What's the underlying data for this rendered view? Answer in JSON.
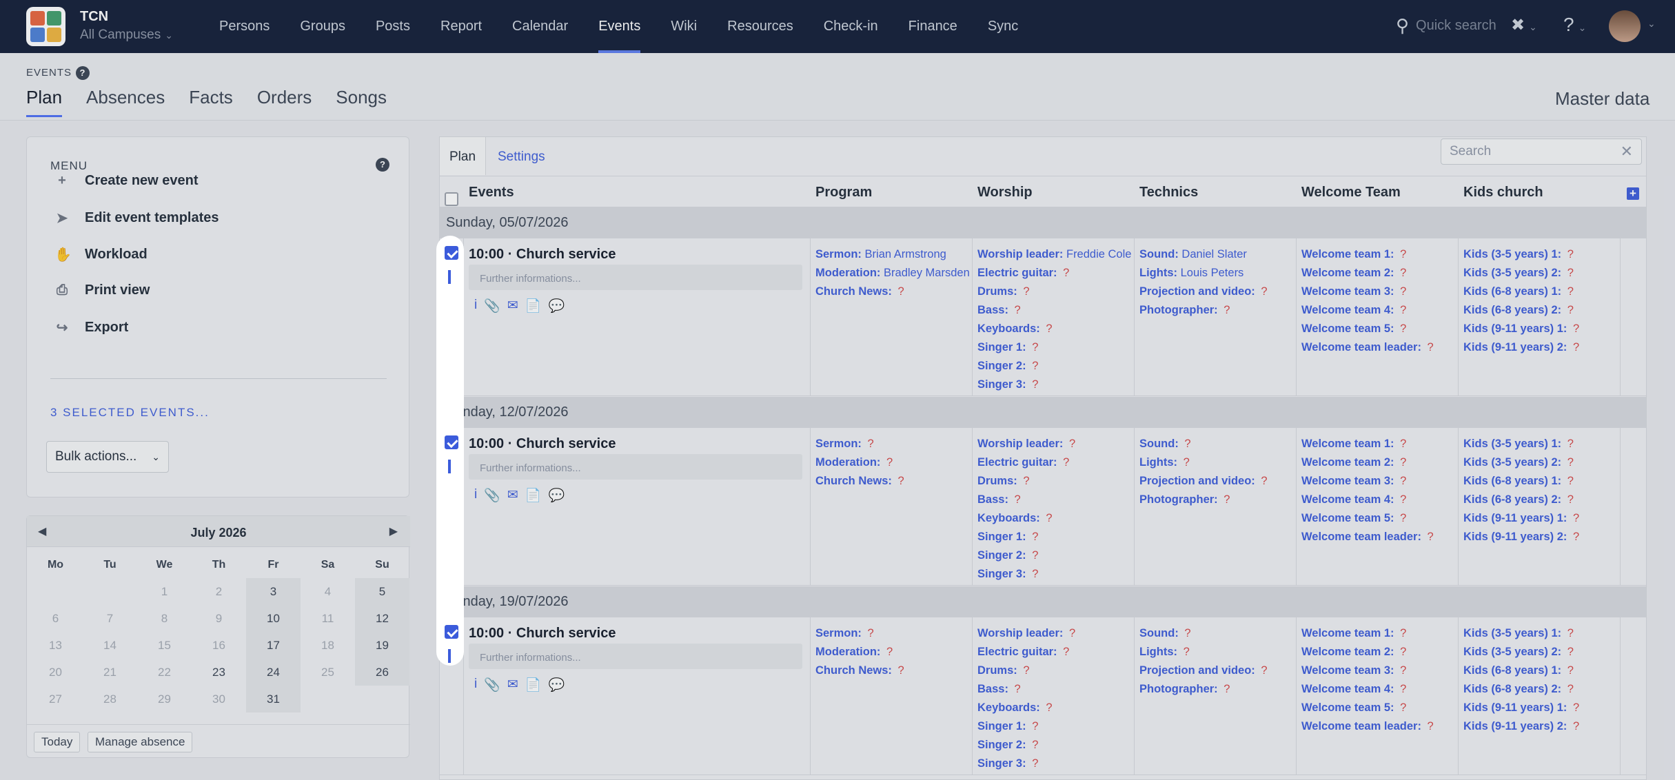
{
  "app": {
    "org": "TCN",
    "campus": "All Campuses"
  },
  "nav": [
    "Persons",
    "Groups",
    "Posts",
    "Report",
    "Calendar",
    "Events",
    "Wiki",
    "Resources",
    "Check-in",
    "Finance",
    "Sync"
  ],
  "nav_active": "Events",
  "quick_search": "Quick search",
  "page": {
    "section_label": "EVENTS",
    "tabs": [
      "Plan",
      "Absences",
      "Facts",
      "Orders",
      "Songs"
    ],
    "active_tab": "Plan",
    "master_data": "Master data"
  },
  "menu": {
    "title": "MENU",
    "items": [
      {
        "label": "Create new event",
        "icon": "plus-icon"
      },
      {
        "label": "Edit event templates",
        "icon": "rocket-icon"
      },
      {
        "label": "Workload",
        "icon": "hand-icon"
      },
      {
        "label": "Print view",
        "icon": "printer-icon"
      },
      {
        "label": "Export",
        "icon": "export-icon"
      }
    ],
    "selected_label": "3 SELECTED EVENTS...",
    "bulk_actions": "Bulk actions..."
  },
  "calendar": {
    "month": "July 2026",
    "weekdays": [
      "Mo",
      "Tu",
      "We",
      "Th",
      "Fr",
      "Sa",
      "Su"
    ],
    "weeks": [
      [
        "",
        "",
        "1",
        "2",
        "3",
        "4",
        "5"
      ],
      [
        "6",
        "7",
        "8",
        "9",
        "10",
        "11",
        "12"
      ],
      [
        "13",
        "14",
        "15",
        "16",
        "17",
        "18",
        "19"
      ],
      [
        "20",
        "21",
        "22",
        "23",
        "24",
        "25",
        "26"
      ],
      [
        "27",
        "28",
        "29",
        "30",
        "31",
        "",
        ""
      ]
    ],
    "today_button": "Today",
    "manage_absence_button": "Manage absence"
  },
  "plan": {
    "tabs": [
      "Plan",
      "Settings"
    ],
    "search_placeholder": "Search",
    "columns": [
      "Events",
      "Program",
      "Worship",
      "Technics",
      "Welcome Team",
      "Kids church"
    ],
    "further_placeholder": "Further informations...",
    "events": [
      {
        "date": "Sunday, 05/07/2026",
        "title": "10:00 · Church service",
        "program": [
          [
            "Sermon:",
            "Brian Armstrong"
          ],
          [
            "Moderation:",
            "Bradley Marsden"
          ],
          [
            "Church News:",
            "?"
          ]
        ],
        "worship": [
          [
            "Worship leader:",
            "Freddie Cole"
          ],
          [
            "Electric guitar:",
            "?"
          ],
          [
            "Drums:",
            "?"
          ],
          [
            "Bass:",
            "?"
          ],
          [
            "Keyboards:",
            "?"
          ],
          [
            "Singer 1:",
            "?"
          ],
          [
            "Singer 2:",
            "?"
          ],
          [
            "Singer 3:",
            "?"
          ]
        ],
        "technics": [
          [
            "Sound:",
            "Daniel Slater"
          ],
          [
            "Lights:",
            "Louis Peters"
          ],
          [
            "Projection and video:",
            "?"
          ],
          [
            "Photographer:",
            "?"
          ]
        ],
        "welcome": [
          [
            "Welcome team 1:",
            "?"
          ],
          [
            "Welcome team 2:",
            "?"
          ],
          [
            "Welcome team 3:",
            "?"
          ],
          [
            "Welcome team 4:",
            "?"
          ],
          [
            "Welcome team 5:",
            "?"
          ],
          [
            "Welcome team leader:",
            "?"
          ]
        ],
        "kids": [
          [
            "Kids (3-5 years) 1:",
            "?"
          ],
          [
            "Kids (3-5 years) 2:",
            "?"
          ],
          [
            "Kids (6-8 years) 1:",
            "?"
          ],
          [
            "Kids (6-8 years) 2:",
            "?"
          ],
          [
            "Kids (9-11 years) 1:",
            "?"
          ],
          [
            "Kids (9-11 years) 2:",
            "?"
          ]
        ]
      },
      {
        "date": "Sunday, 12/07/2026",
        "title": "10:00 · Church service",
        "program": [
          [
            "Sermon:",
            "?"
          ],
          [
            "Moderation:",
            "?"
          ],
          [
            "Church News:",
            "?"
          ]
        ],
        "worship": [
          [
            "Worship leader:",
            "?"
          ],
          [
            "Electric guitar:",
            "?"
          ],
          [
            "Drums:",
            "?"
          ],
          [
            "Bass:",
            "?"
          ],
          [
            "Keyboards:",
            "?"
          ],
          [
            "Singer 1:",
            "?"
          ],
          [
            "Singer 2:",
            "?"
          ],
          [
            "Singer 3:",
            "?"
          ]
        ],
        "technics": [
          [
            "Sound:",
            "?"
          ],
          [
            "Lights:",
            "?"
          ],
          [
            "Projection and video:",
            "?"
          ],
          [
            "Photographer:",
            "?"
          ]
        ],
        "welcome": [
          [
            "Welcome team 1:",
            "?"
          ],
          [
            "Welcome team 2:",
            "?"
          ],
          [
            "Welcome team 3:",
            "?"
          ],
          [
            "Welcome team 4:",
            "?"
          ],
          [
            "Welcome team 5:",
            "?"
          ],
          [
            "Welcome team leader:",
            "?"
          ]
        ],
        "kids": [
          [
            "Kids (3-5 years) 1:",
            "?"
          ],
          [
            "Kids (3-5 years) 2:",
            "?"
          ],
          [
            "Kids (6-8 years) 1:",
            "?"
          ],
          [
            "Kids (6-8 years) 2:",
            "?"
          ],
          [
            "Kids (9-11 years) 1:",
            "?"
          ],
          [
            "Kids (9-11 years) 2:",
            "?"
          ]
        ]
      },
      {
        "date": "Sunday, 19/07/2026",
        "title": "10:00 · Church service",
        "program": [
          [
            "Sermon:",
            "?"
          ],
          [
            "Moderation:",
            "?"
          ],
          [
            "Church News:",
            "?"
          ]
        ],
        "worship": [
          [
            "Worship leader:",
            "?"
          ],
          [
            "Electric guitar:",
            "?"
          ],
          [
            "Drums:",
            "?"
          ],
          [
            "Bass:",
            "?"
          ],
          [
            "Keyboards:",
            "?"
          ],
          [
            "Singer 1:",
            "?"
          ],
          [
            "Singer 2:",
            "?"
          ],
          [
            "Singer 3:",
            "?"
          ]
        ],
        "technics": [
          [
            "Sound:",
            "?"
          ],
          [
            "Lights:",
            "?"
          ],
          [
            "Projection and video:",
            "?"
          ],
          [
            "Photographer:",
            "?"
          ]
        ],
        "welcome": [
          [
            "Welcome team 1:",
            "?"
          ],
          [
            "Welcome team 2:",
            "?"
          ],
          [
            "Welcome team 3:",
            "?"
          ],
          [
            "Welcome team 4:",
            "?"
          ],
          [
            "Welcome team 5:",
            "?"
          ],
          [
            "Welcome team leader:",
            "?"
          ]
        ],
        "kids": [
          [
            "Kids (3-5 years) 1:",
            "?"
          ],
          [
            "Kids (3-5 years) 2:",
            "?"
          ],
          [
            "Kids (6-8 years) 1:",
            "?"
          ],
          [
            "Kids (6-8 years) 2:",
            "?"
          ],
          [
            "Kids (9-11 years) 1:",
            "?"
          ],
          [
            "Kids (9-11 years) 2:",
            "?"
          ]
        ]
      }
    ]
  },
  "colors": {
    "nav_bg": "#0f1b35",
    "accent": "#3b5bdb",
    "unassigned": "#d64545"
  }
}
